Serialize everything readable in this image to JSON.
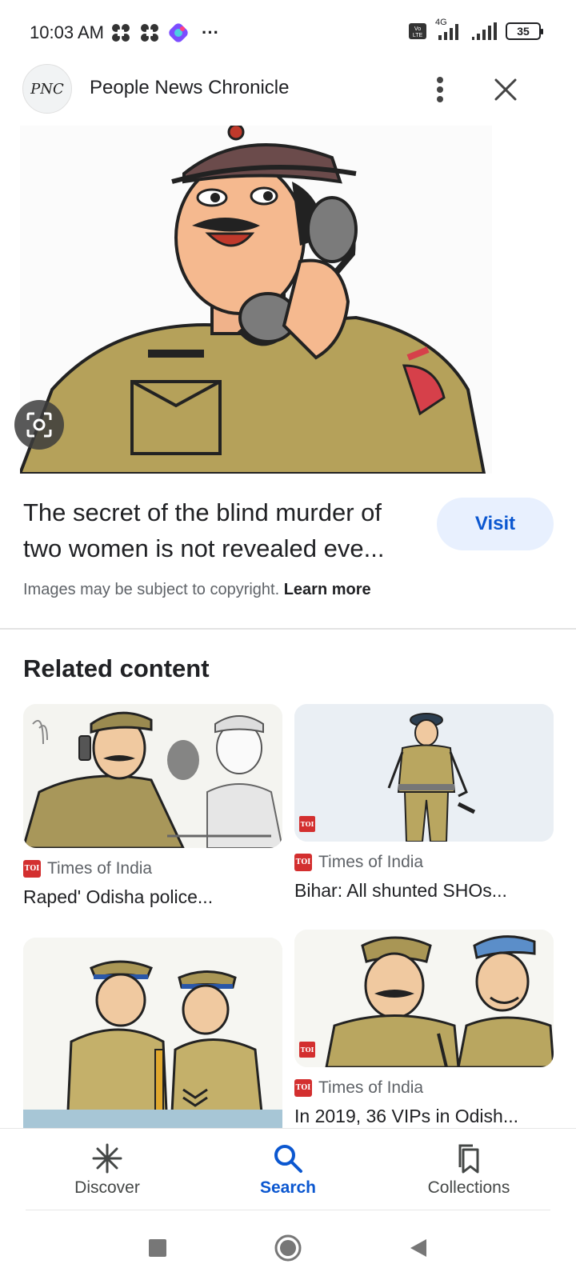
{
  "status_bar": {
    "time": "10:03 AM",
    "more": "···",
    "network": "4G",
    "battery": "35"
  },
  "source": {
    "logo_text": "PNC",
    "name": "People News Chronicle"
  },
  "image": {
    "title": "The secret of the blind murder of two women is not revealed eve...",
    "visit_label": "Visit",
    "copyright_text": "Images may be subject to copyright.",
    "learn_more": "Learn more"
  },
  "related": {
    "heading": "Related content",
    "cards": [
      {
        "source": "Times of India",
        "title": "Raped' Odisha police...",
        "badge": "TOI"
      },
      {
        "source": "Times of India",
        "title": "Bihar: All shunted SHOs...",
        "badge": "TOI"
      },
      {
        "source": "",
        "title": "",
        "badge": ""
      },
      {
        "source": "Times of India",
        "title": "In 2019, 36 VIPs in Odish...",
        "badge": "TOI"
      }
    ]
  },
  "bottom_nav": {
    "items": [
      {
        "label": "Discover",
        "icon": "asterisk-icon",
        "active": false
      },
      {
        "label": "Search",
        "icon": "search-icon",
        "active": true
      },
      {
        "label": "Collections",
        "icon": "collections-icon",
        "active": false
      }
    ]
  },
  "colors": {
    "accent": "#0b57d0",
    "visit_bg": "#e8f0fe",
    "toi_red": "#d32f2f",
    "uniform_khaki": "#b5a15a"
  }
}
